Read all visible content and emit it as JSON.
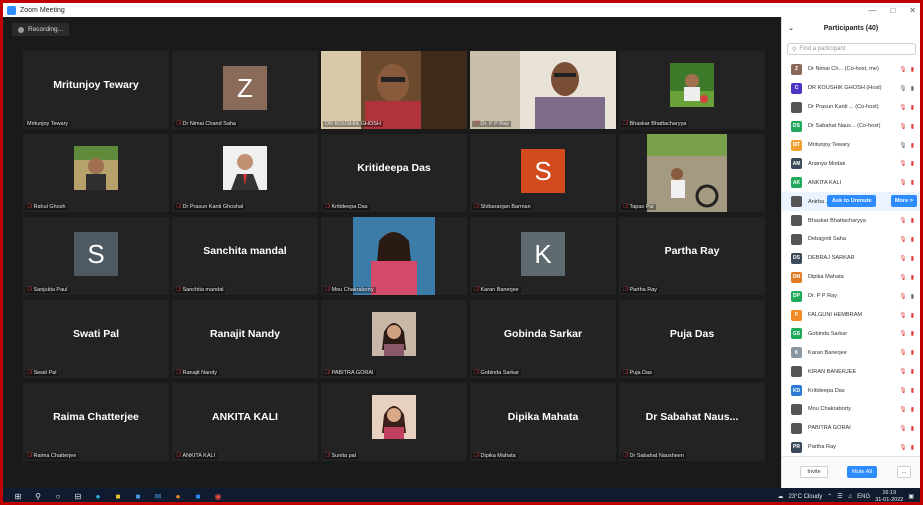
{
  "window": {
    "title": "Zoom Meeting"
  },
  "recording": {
    "label": "Recording..."
  },
  "tiles": [
    {
      "kind": "name",
      "center": "Mritunjoy Tewary",
      "label": "Mritunjoy Tewary",
      "muted": false
    },
    {
      "kind": "letter",
      "letter": "Z",
      "color": "#8a6a58",
      "label": "Dr Nimai Chand Saha",
      "muted": true
    },
    {
      "kind": "photo",
      "scene": "man-video",
      "label": "DR KOUSHIK GHOSH",
      "muted": false,
      "active": true
    },
    {
      "kind": "photo",
      "scene": "man-video-2",
      "label": "Dr. P P Ray",
      "muted": true
    },
    {
      "kind": "small",
      "scene": "outdoor-pic",
      "label": "Bhaskar Bhattacharyya",
      "muted": true
    },
    {
      "kind": "small",
      "scene": "boy-pic",
      "label": "Rahul Ghosh",
      "muted": true
    },
    {
      "kind": "small",
      "scene": "suit-pic",
      "label": "Dr Prasun Kanti Ghoshal",
      "muted": true
    },
    {
      "kind": "name",
      "center": "Kritideepa Das",
      "label": "Kritideepa Das",
      "muted": true
    },
    {
      "kind": "letter",
      "letter": "S",
      "color": "#d44a1f",
      "label": "Shibaranjan Barman",
      "muted": true
    },
    {
      "kind": "small",
      "scene": "bike-pic",
      "label": "Tapas Pal",
      "muted": true
    },
    {
      "kind": "letter",
      "letter": "S",
      "color": "#4e5a63",
      "label": "Sanjukta Paul",
      "muted": true
    },
    {
      "kind": "name",
      "center": "Sanchita mandal",
      "label": "Sanchita mandal",
      "muted": true
    },
    {
      "kind": "small",
      "scene": "woman-pic",
      "label": "Mou Chakraborty",
      "muted": true
    },
    {
      "kind": "letter",
      "letter": "K",
      "color": "#5e6a70",
      "label": "Karan Banerjee",
      "muted": true
    },
    {
      "kind": "name",
      "center": "Partha Ray",
      "label": "Partha Ray",
      "muted": true
    },
    {
      "kind": "name",
      "center": "Swati Pal",
      "label": "Swati Pal",
      "muted": true
    },
    {
      "kind": "name",
      "center": "Ranajit Nandy",
      "label": "Ranajit Nandy",
      "muted": true
    },
    {
      "kind": "small",
      "scene": "girl-pic",
      "label": "PABITRA GORAI",
      "muted": true
    },
    {
      "kind": "name",
      "center": "Gobinda Sarkar",
      "label": "Gobinda Sarkar",
      "muted": true
    },
    {
      "kind": "name",
      "center": "Puja Das",
      "label": "Puja Das",
      "muted": true
    },
    {
      "kind": "name",
      "center": "Raima Chatterjee",
      "label": "Raima Chatterjee",
      "muted": true
    },
    {
      "kind": "name",
      "center": "ANKITA KALI",
      "label": "ANKITA KALI",
      "muted": true
    },
    {
      "kind": "small",
      "scene": "girl-pic-2",
      "label": "Sunita pal",
      "muted": true
    },
    {
      "kind": "name",
      "center": "Dipika Mahata",
      "label": "Dipika Mahata",
      "muted": true
    },
    {
      "kind": "name",
      "center": "Dr Sabahat Naus...",
      "label": "Dr Sabahat Nausheen",
      "muted": true
    }
  ],
  "panel": {
    "title": "Participants (40)",
    "search_placeholder": "Find a participant",
    "ask_label": "Ask to Unmute",
    "more_label": "More >",
    "invite_label": "Invite",
    "muteall_label": "Mute All",
    "more_dots": "...",
    "participants": [
      {
        "av": "Z",
        "color": "#8a6a58",
        "name": "Dr Nimai Ch... (Co-host, me)",
        "mic": "off",
        "video": "off"
      },
      {
        "av": "C",
        "color": "#4a35c4",
        "name": "DR KOUSHIK GHOSH (Host)",
        "mic": "on",
        "video": "on"
      },
      {
        "av": "",
        "color": "#555555",
        "name": "Dr Prasun Kanti ... (Co-host)",
        "mic": "off",
        "video": "off",
        "photo": true
      },
      {
        "av": "DS",
        "color": "#1eaa5a",
        "name": "Dr Sabahat Naus... (Co-host)",
        "mic": "off",
        "video": "off"
      },
      {
        "av": "MT",
        "color": "#f0a030",
        "name": "Mritunjoy Tewary",
        "mic": "on",
        "video": "off"
      },
      {
        "av": "AM",
        "color": "#3b4a5a",
        "name": "Ananya Modak",
        "mic": "off",
        "video": "off"
      },
      {
        "av": "AK",
        "color": "#1eaa5a",
        "name": "ANKITA KALI",
        "mic": "off",
        "video": "off"
      },
      {
        "av": "",
        "color": "#555555",
        "name": "Anirba ...",
        "mic": "",
        "video": "",
        "photo": true,
        "hover": true
      },
      {
        "av": "",
        "color": "#555555",
        "name": "Bhaskar Bhattacharyya",
        "mic": "off",
        "video": "off",
        "photo": true
      },
      {
        "av": "",
        "color": "#555555",
        "name": "Debajyoti Saha",
        "mic": "off",
        "video": "off",
        "photo": true
      },
      {
        "av": "DS",
        "color": "#3b4a5a",
        "name": "DEBRAJ SARKAR",
        "mic": "off",
        "video": "off"
      },
      {
        "av": "DM",
        "color": "#e07b22",
        "name": "Dipika Mahata",
        "mic": "off",
        "video": "off"
      },
      {
        "av": "DP",
        "color": "#1eaa5a",
        "name": "Dr. P P Ray",
        "mic": "off",
        "video": "on"
      },
      {
        "av": "F",
        "color": "#f08a24",
        "name": "FALGUNI HEMBRAM",
        "mic": "off",
        "video": "off"
      },
      {
        "av": "GS",
        "color": "#1eaa5a",
        "name": "Gobinda Sarkar",
        "mic": "off",
        "video": "off"
      },
      {
        "av": "K",
        "color": "#8a96a0",
        "name": "Karan Banerjee",
        "mic": "off",
        "video": "off"
      },
      {
        "av": "",
        "color": "#555555",
        "name": "KIRAN BANERJEE",
        "mic": "off",
        "video": "off",
        "photo": true
      },
      {
        "av": "KD",
        "color": "#2d7bd6",
        "name": "Kritideepa Das",
        "mic": "off",
        "video": "off"
      },
      {
        "av": "",
        "color": "#555555",
        "name": "Mou Chakraborty",
        "mic": "off",
        "video": "off",
        "photo": true
      },
      {
        "av": "",
        "color": "#555555",
        "name": "PABITRA GORAI",
        "mic": "off",
        "video": "off",
        "photo": true
      },
      {
        "av": "PR",
        "color": "#3b4a5a",
        "name": "Partha Ray",
        "mic": "off",
        "video": "off"
      }
    ]
  },
  "taskbar": {
    "weather": "23°C  Cloudy",
    "lang": "ENG",
    "time": "16:19",
    "date": "31-01-2022"
  }
}
